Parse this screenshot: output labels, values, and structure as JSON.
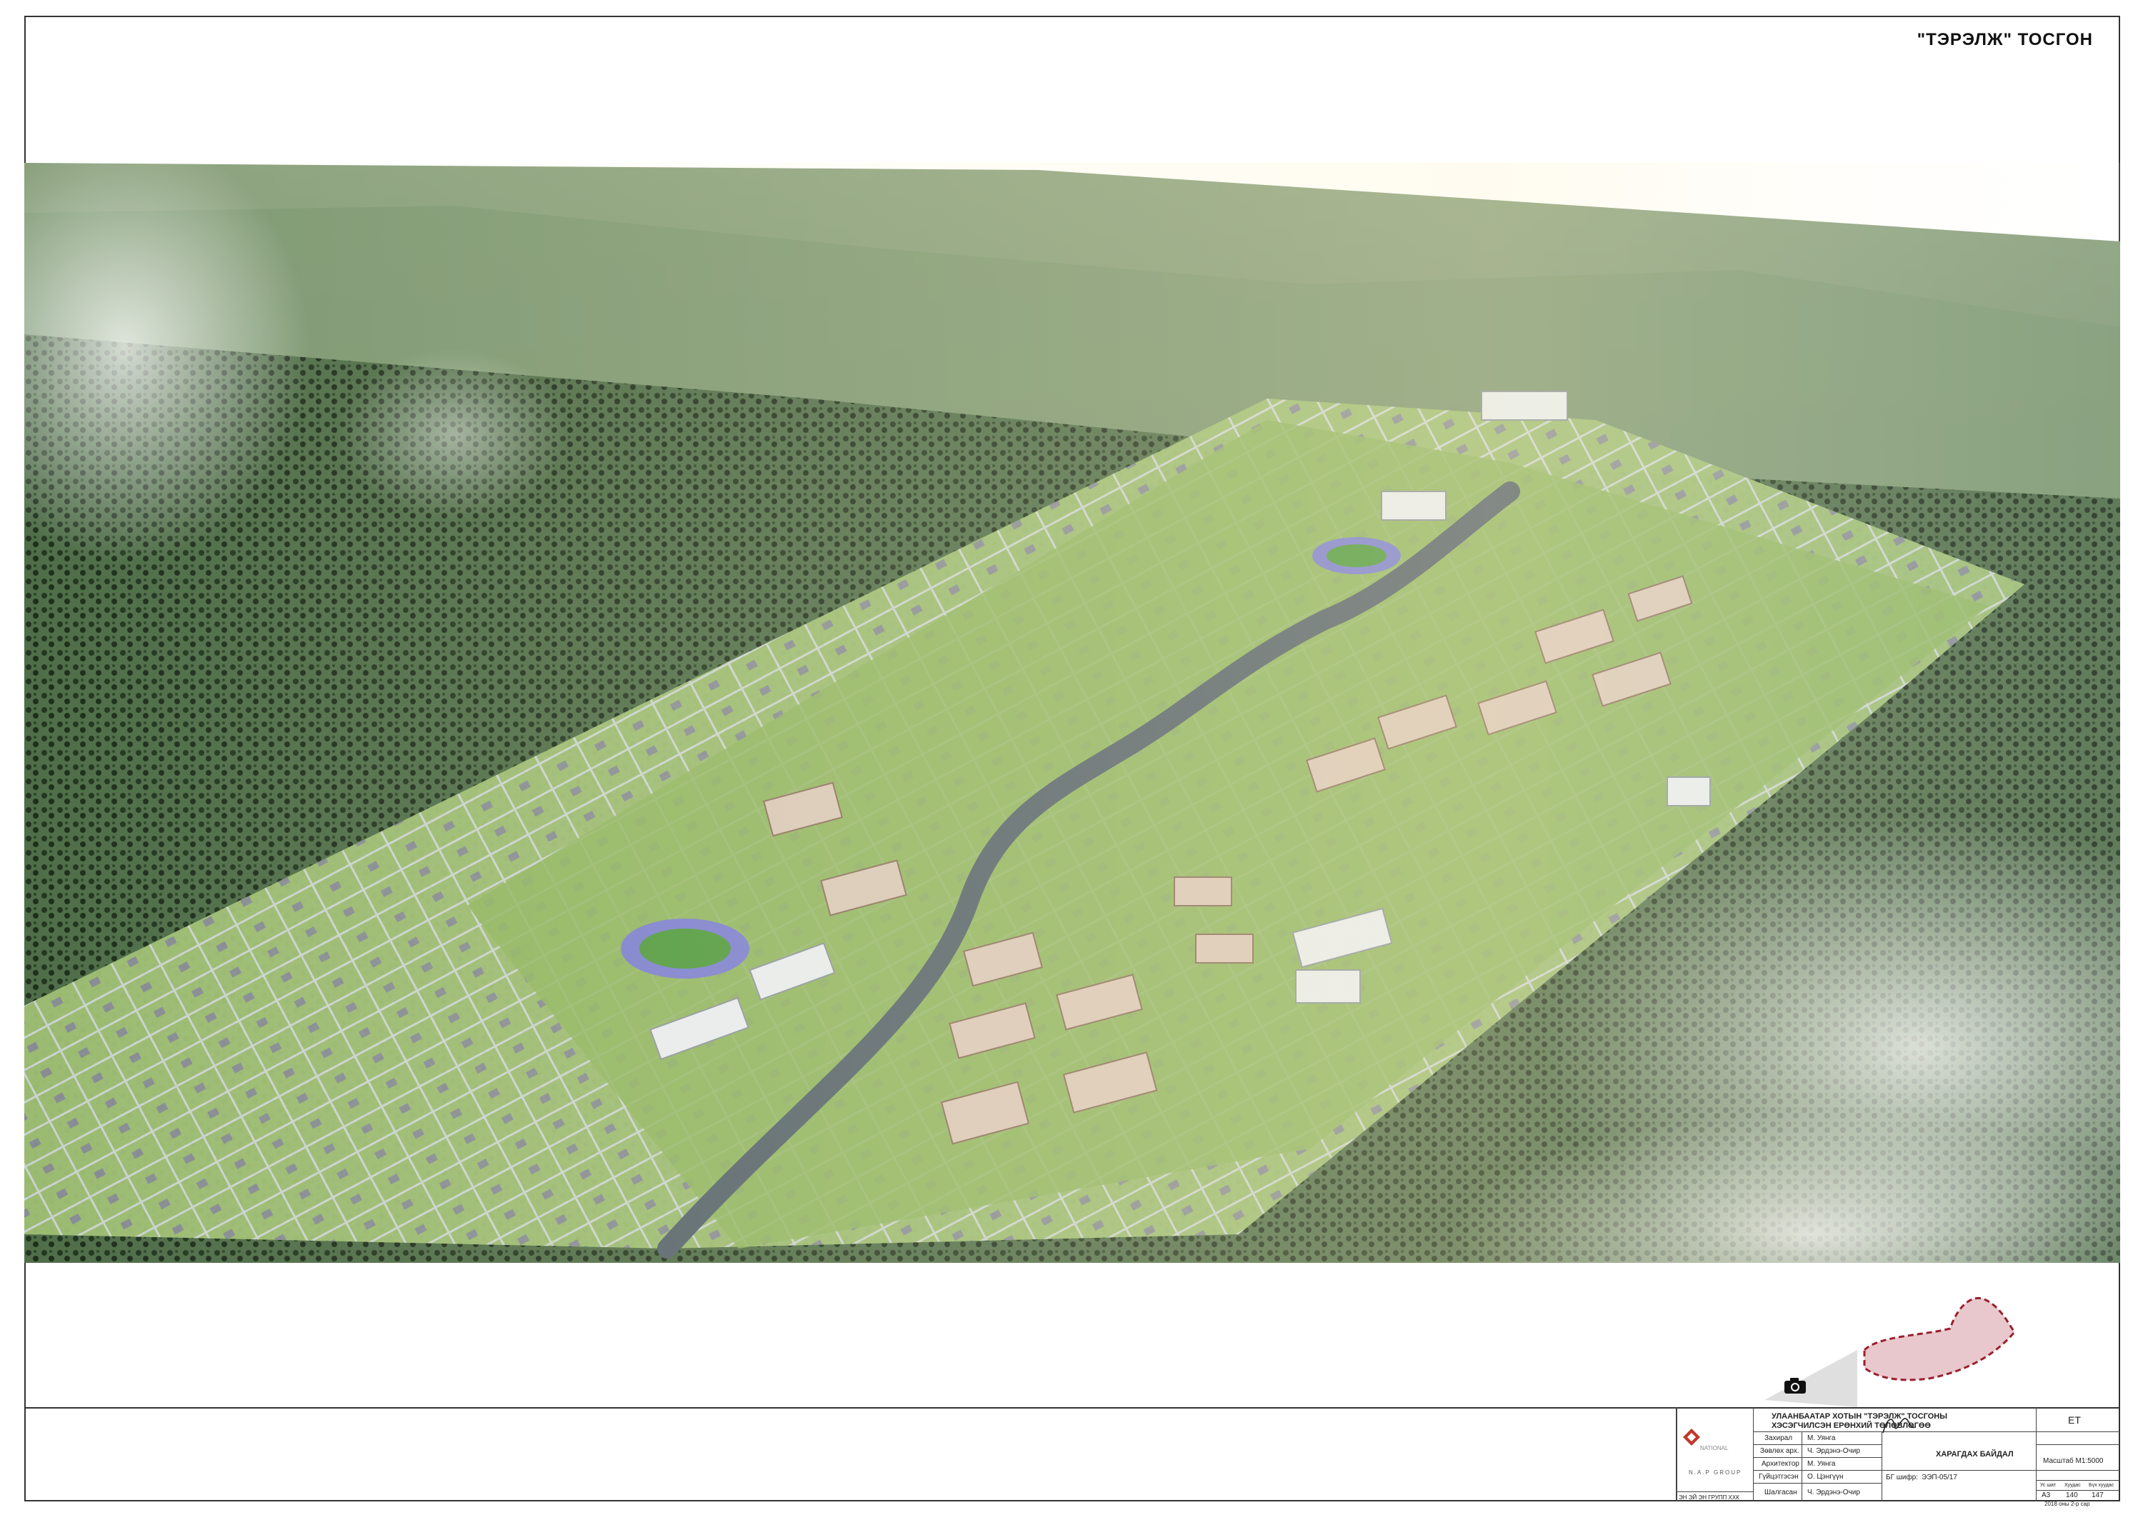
{
  "sheet": {
    "title": "\"ТЭРЭЛЖ\" ТОСГОН"
  },
  "title_block": {
    "project_line1": "УЛААНБААТАР ХОТЫН \"ТЭРЭЛЖ\" ТОСГОНЫ",
    "project_line2": "ХЭСЭГЧИЛСЭН ЕРӨНХИЙ ТӨЛӨВЛӨГӨӨ",
    "stage": "ЕТ",
    "drawing_name": "ХАРАГДАХ БАЙДАЛ",
    "scale": "Масштаб М1:5000",
    "roles": [
      {
        "role": "Захирал",
        "name": "М. Уянга"
      },
      {
        "role": "Зөвлөх арх.",
        "name": "Ч. Эрдэнэ-Очир"
      },
      {
        "role": "Архитектор",
        "name": "М. Уянга"
      },
      {
        "role": "Гүйцэтгэсэн",
        "name": "О. Цэнгүүн"
      },
      {
        "role": "Шалгасан",
        "name": "Ч. Эрдэнэ-Очир"
      }
    ],
    "code_label": "БГ шифр:",
    "code_value": "ЭЭП-05/17",
    "format_header": "Ус шат",
    "sheet_header": "Хуудас",
    "total_header": "Бүх хуудас",
    "format_value": "А3",
    "sheet_value": "140",
    "total_value": "147",
    "date": "2018 оны 2-р сар",
    "company_footer": "ЭН ЭЙ ЭН ГРУПП ХХК",
    "logo_line1": "NATIONAL",
    "logo_line2": "N.A.P GROUP"
  },
  "icons": [
    "camera-icon",
    "company-logo",
    "key-map"
  ],
  "colors": {
    "frame": "#333333",
    "keymap_fill": "#e8c8cc",
    "keymap_outline": "#9b1f2e"
  }
}
